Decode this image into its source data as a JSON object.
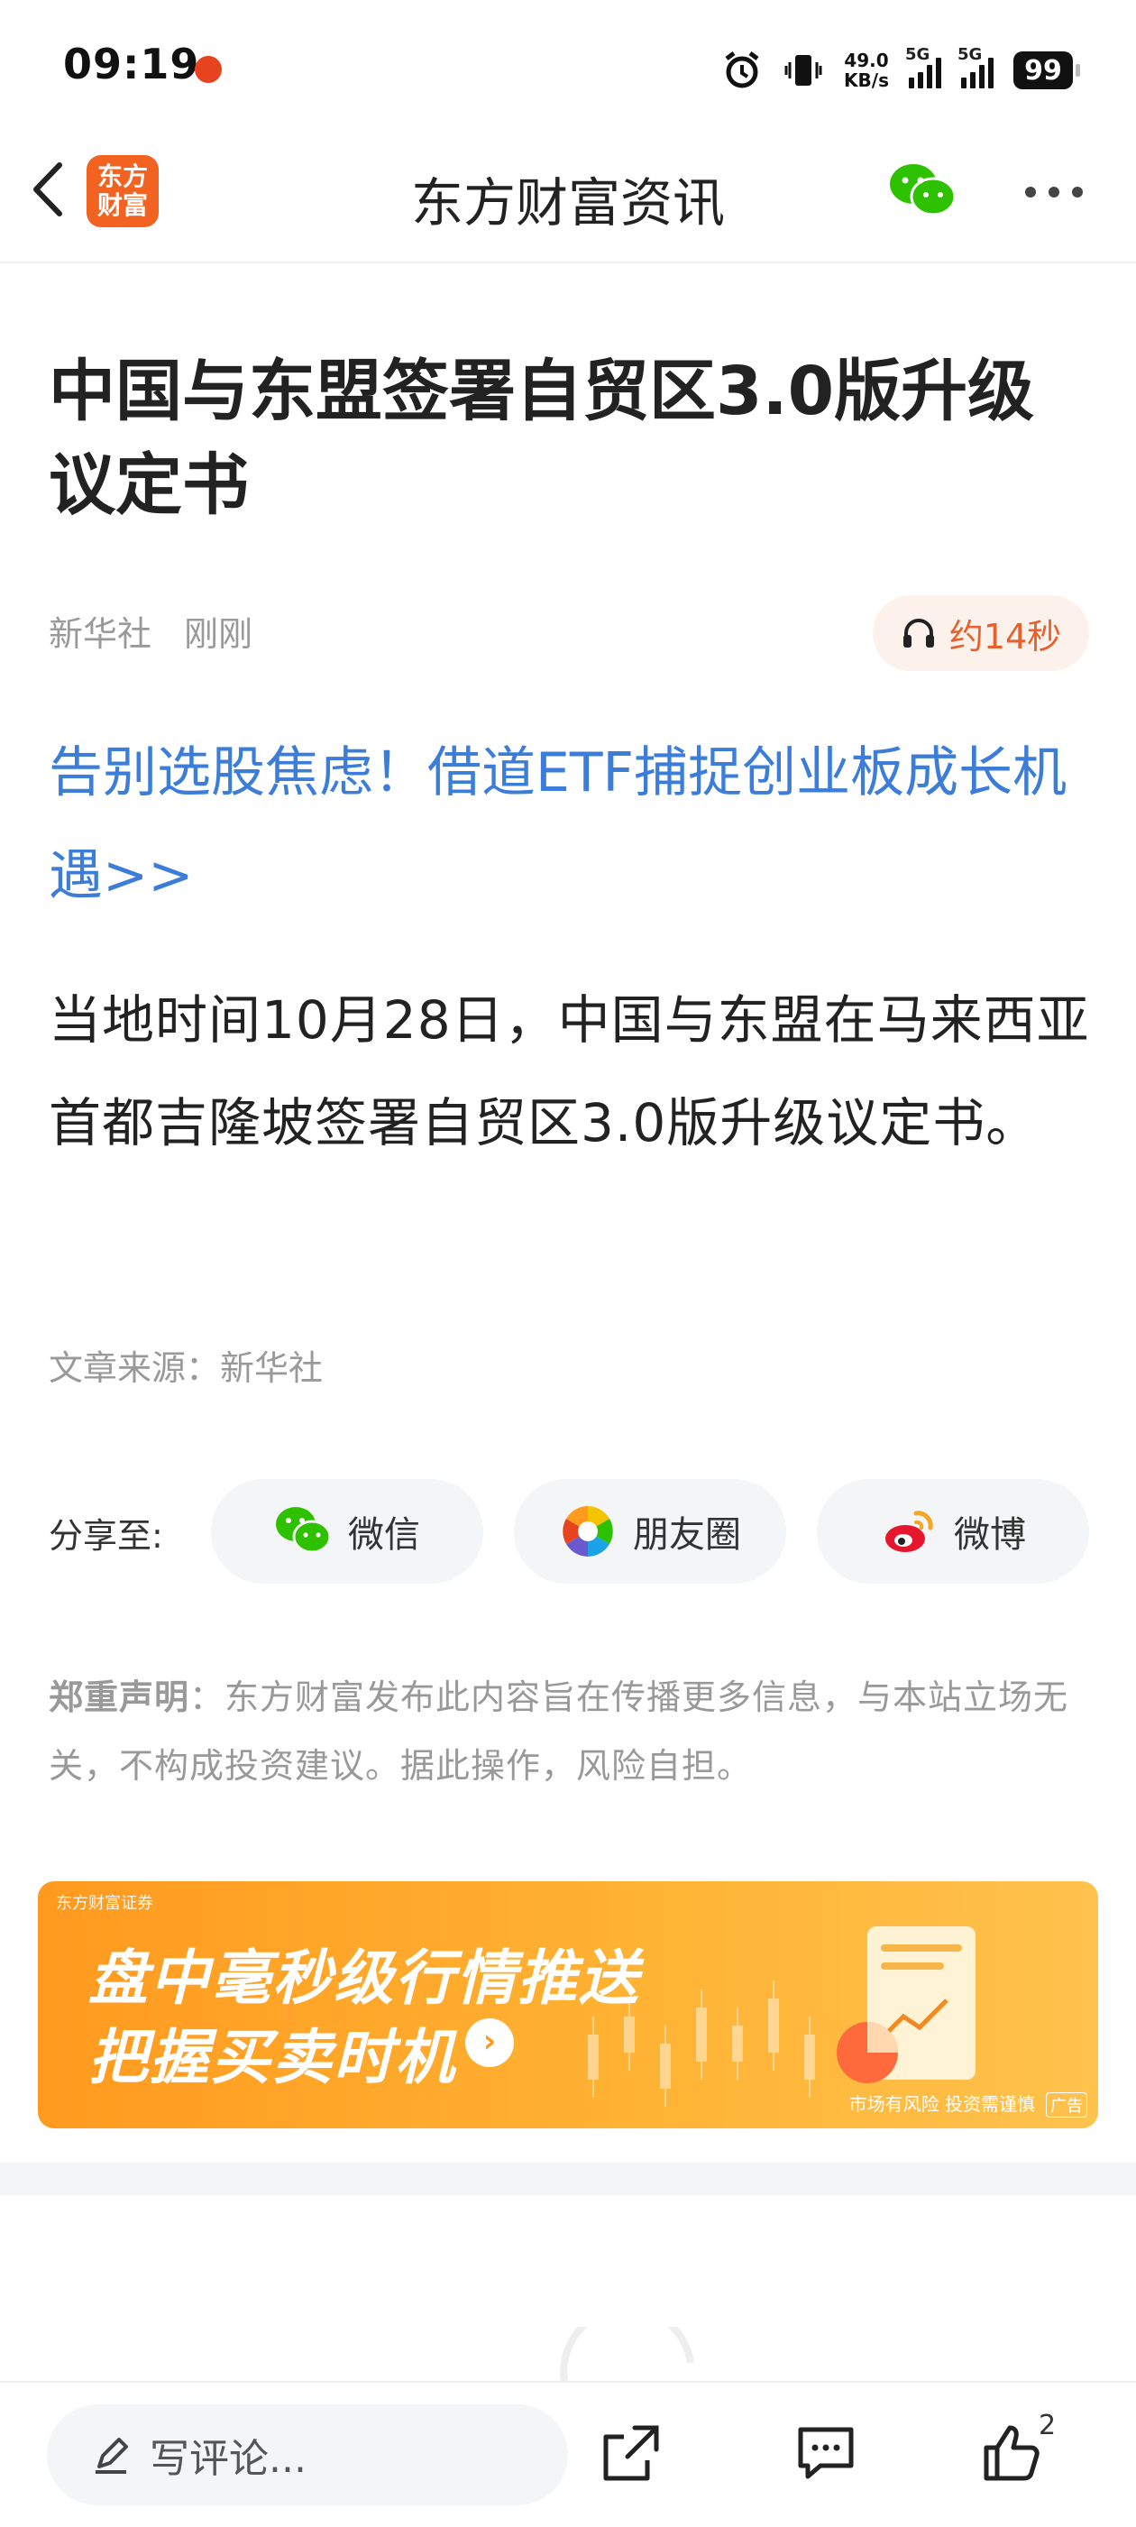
{
  "status_bar": {
    "time": "09:19",
    "net_speed_value": "49.0",
    "net_speed_unit": "KB/s",
    "signal1_label": "5G",
    "signal2_label": "5G",
    "battery": "99"
  },
  "nav": {
    "logo_line1": "东方",
    "logo_line2": "财富",
    "title": "东方财富资讯"
  },
  "article": {
    "title": "中国与东盟签署自贸区3.0版升级议定书",
    "source": "新华社",
    "time": "刚刚",
    "audio_duration": "约14秒",
    "promo_link": "告别选股焦虑！借道ETF捕捉创业板成长机遇>>",
    "body": "当地时间10月28日，中国与东盟在马来西亚首都吉隆坡签署自贸区3.0版升级议定书。",
    "source_line": "文章来源：新华社"
  },
  "share": {
    "label": "分享至:",
    "buttons": [
      {
        "label": "微信",
        "icon": "wechat-icon"
      },
      {
        "label": "朋友圈",
        "icon": "moments-icon"
      },
      {
        "label": "微博",
        "icon": "weibo-icon"
      }
    ]
  },
  "disclaimer": {
    "title": "郑重声明",
    "text": "：东方财富发布此内容旨在传播更多信息，与本站立场无关，不构成投资建议。据此操作，风险自担。"
  },
  "ad": {
    "brand": "东方财富证券",
    "line1": "盘中毫秒级行情推送",
    "line2": "把握买卖时机",
    "risk": "市场有风险 投资需谨慎",
    "tag": "广告"
  },
  "bottom_bar": {
    "comment_placeholder": "写评论...",
    "like_count": "2"
  },
  "colors": {
    "accent_orange": "#f26322",
    "link_blue": "#3b7dd8",
    "wechat_green": "#2dc100"
  }
}
